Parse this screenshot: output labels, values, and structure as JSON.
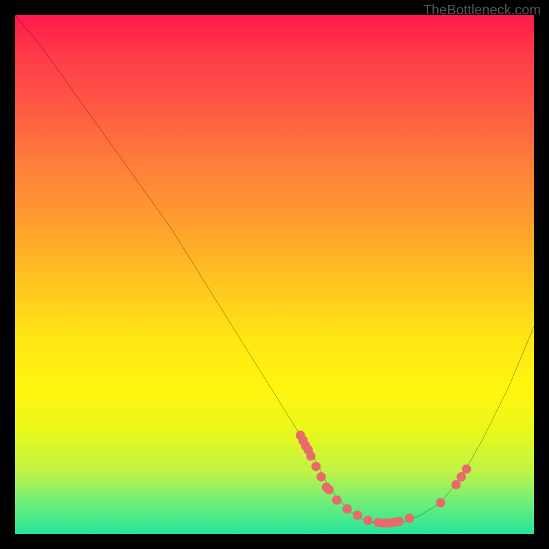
{
  "watermark": "TheBottleneck.com",
  "chart_data": {
    "type": "line",
    "title": "",
    "xlabel": "",
    "ylabel": "",
    "xlim": [
      0,
      100
    ],
    "ylim": [
      0,
      100
    ],
    "line": {
      "x": [
        0,
        5,
        10,
        15,
        20,
        25,
        30,
        35,
        40,
        45,
        50,
        55,
        58,
        60,
        62,
        65,
        68,
        70,
        72,
        75,
        78,
        82,
        86,
        90,
        95,
        100
      ],
      "y": [
        100,
        94,
        87,
        80,
        73,
        66,
        59,
        51,
        43,
        35,
        27,
        19,
        14,
        10,
        7,
        4,
        2.3,
        2,
        2,
        2.3,
        3.5,
        6,
        11,
        18,
        28,
        40
      ]
    },
    "scatter": {
      "x": [
        55,
        55.5,
        56,
        56.5,
        57,
        58,
        59,
        60,
        60.5,
        62,
        64,
        66,
        68,
        70,
        71,
        72,
        73,
        74,
        76,
        82,
        85,
        86,
        87
      ],
      "y": [
        19,
        18,
        17,
        16.2,
        15,
        13,
        11,
        9,
        8.5,
        6.5,
        4.8,
        3.6,
        2.6,
        2.2,
        2.1,
        2.1,
        2.2,
        2.4,
        3,
        6,
        9.5,
        11,
        12.5
      ]
    },
    "colors": {
      "line": "#000000",
      "scatter": "#e96a6a"
    }
  }
}
